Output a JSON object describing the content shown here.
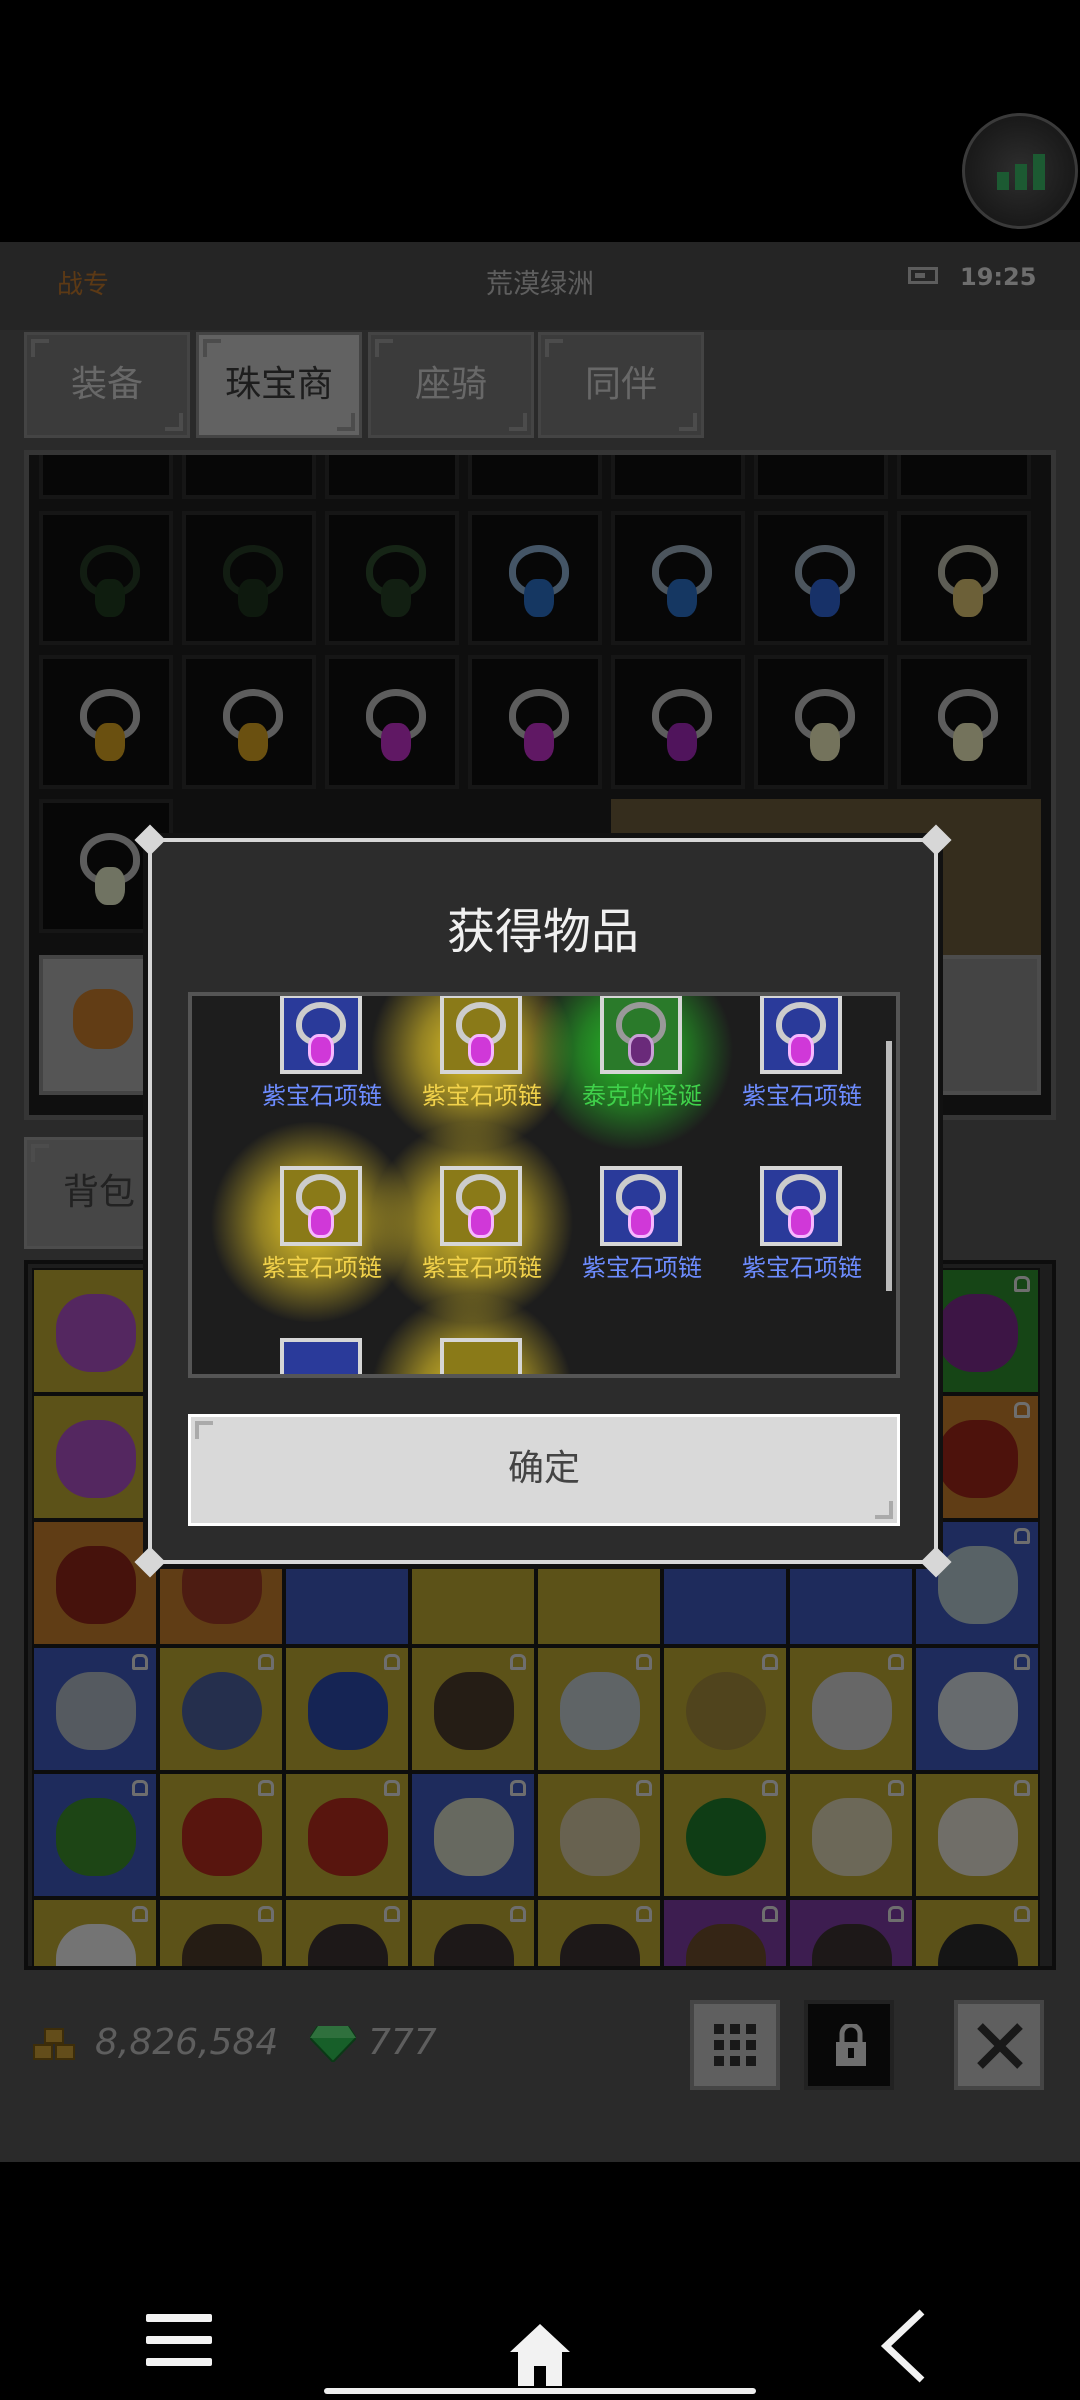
{
  "header": {
    "left_label": "战专",
    "title": "荒漠绿洲",
    "time": "19:25"
  },
  "tabs": [
    {
      "label": "装备",
      "active": false
    },
    {
      "label": "珠宝商",
      "active": true
    },
    {
      "label": "座骑",
      "active": false
    },
    {
      "label": "同伴",
      "active": false
    }
  ],
  "inventory_tab": {
    "label": "背包"
  },
  "currency": {
    "gold": "8,826,584",
    "gems": "777"
  },
  "modal": {
    "title": "获得物品",
    "confirm_label": "确定",
    "rewards": [
      {
        "name": "紫宝石项链",
        "rarity": "blue"
      },
      {
        "name": "紫宝石项链",
        "rarity": "gold"
      },
      {
        "name": "泰克的怪诞",
        "rarity": "green"
      },
      {
        "name": "紫宝石项链",
        "rarity": "blue"
      },
      {
        "name": "紫宝石项链",
        "rarity": "gold"
      },
      {
        "name": "紫宝石项链",
        "rarity": "gold"
      },
      {
        "name": "紫宝石项链",
        "rarity": "blue"
      },
      {
        "name": "紫宝石项链",
        "rarity": "blue"
      }
    ]
  },
  "colors": {
    "blue_label": "#6d8cff",
    "gold_label": "#f2d24a",
    "green_label": "#3fd14a",
    "accent_orange": "#b8732a"
  },
  "icons": [
    "signal-icon",
    "battery-icon",
    "gold-coin-icon",
    "gem-icon",
    "grid-icon",
    "lock-icon",
    "close-icon",
    "menu-icon",
    "home-icon",
    "back-icon"
  ]
}
